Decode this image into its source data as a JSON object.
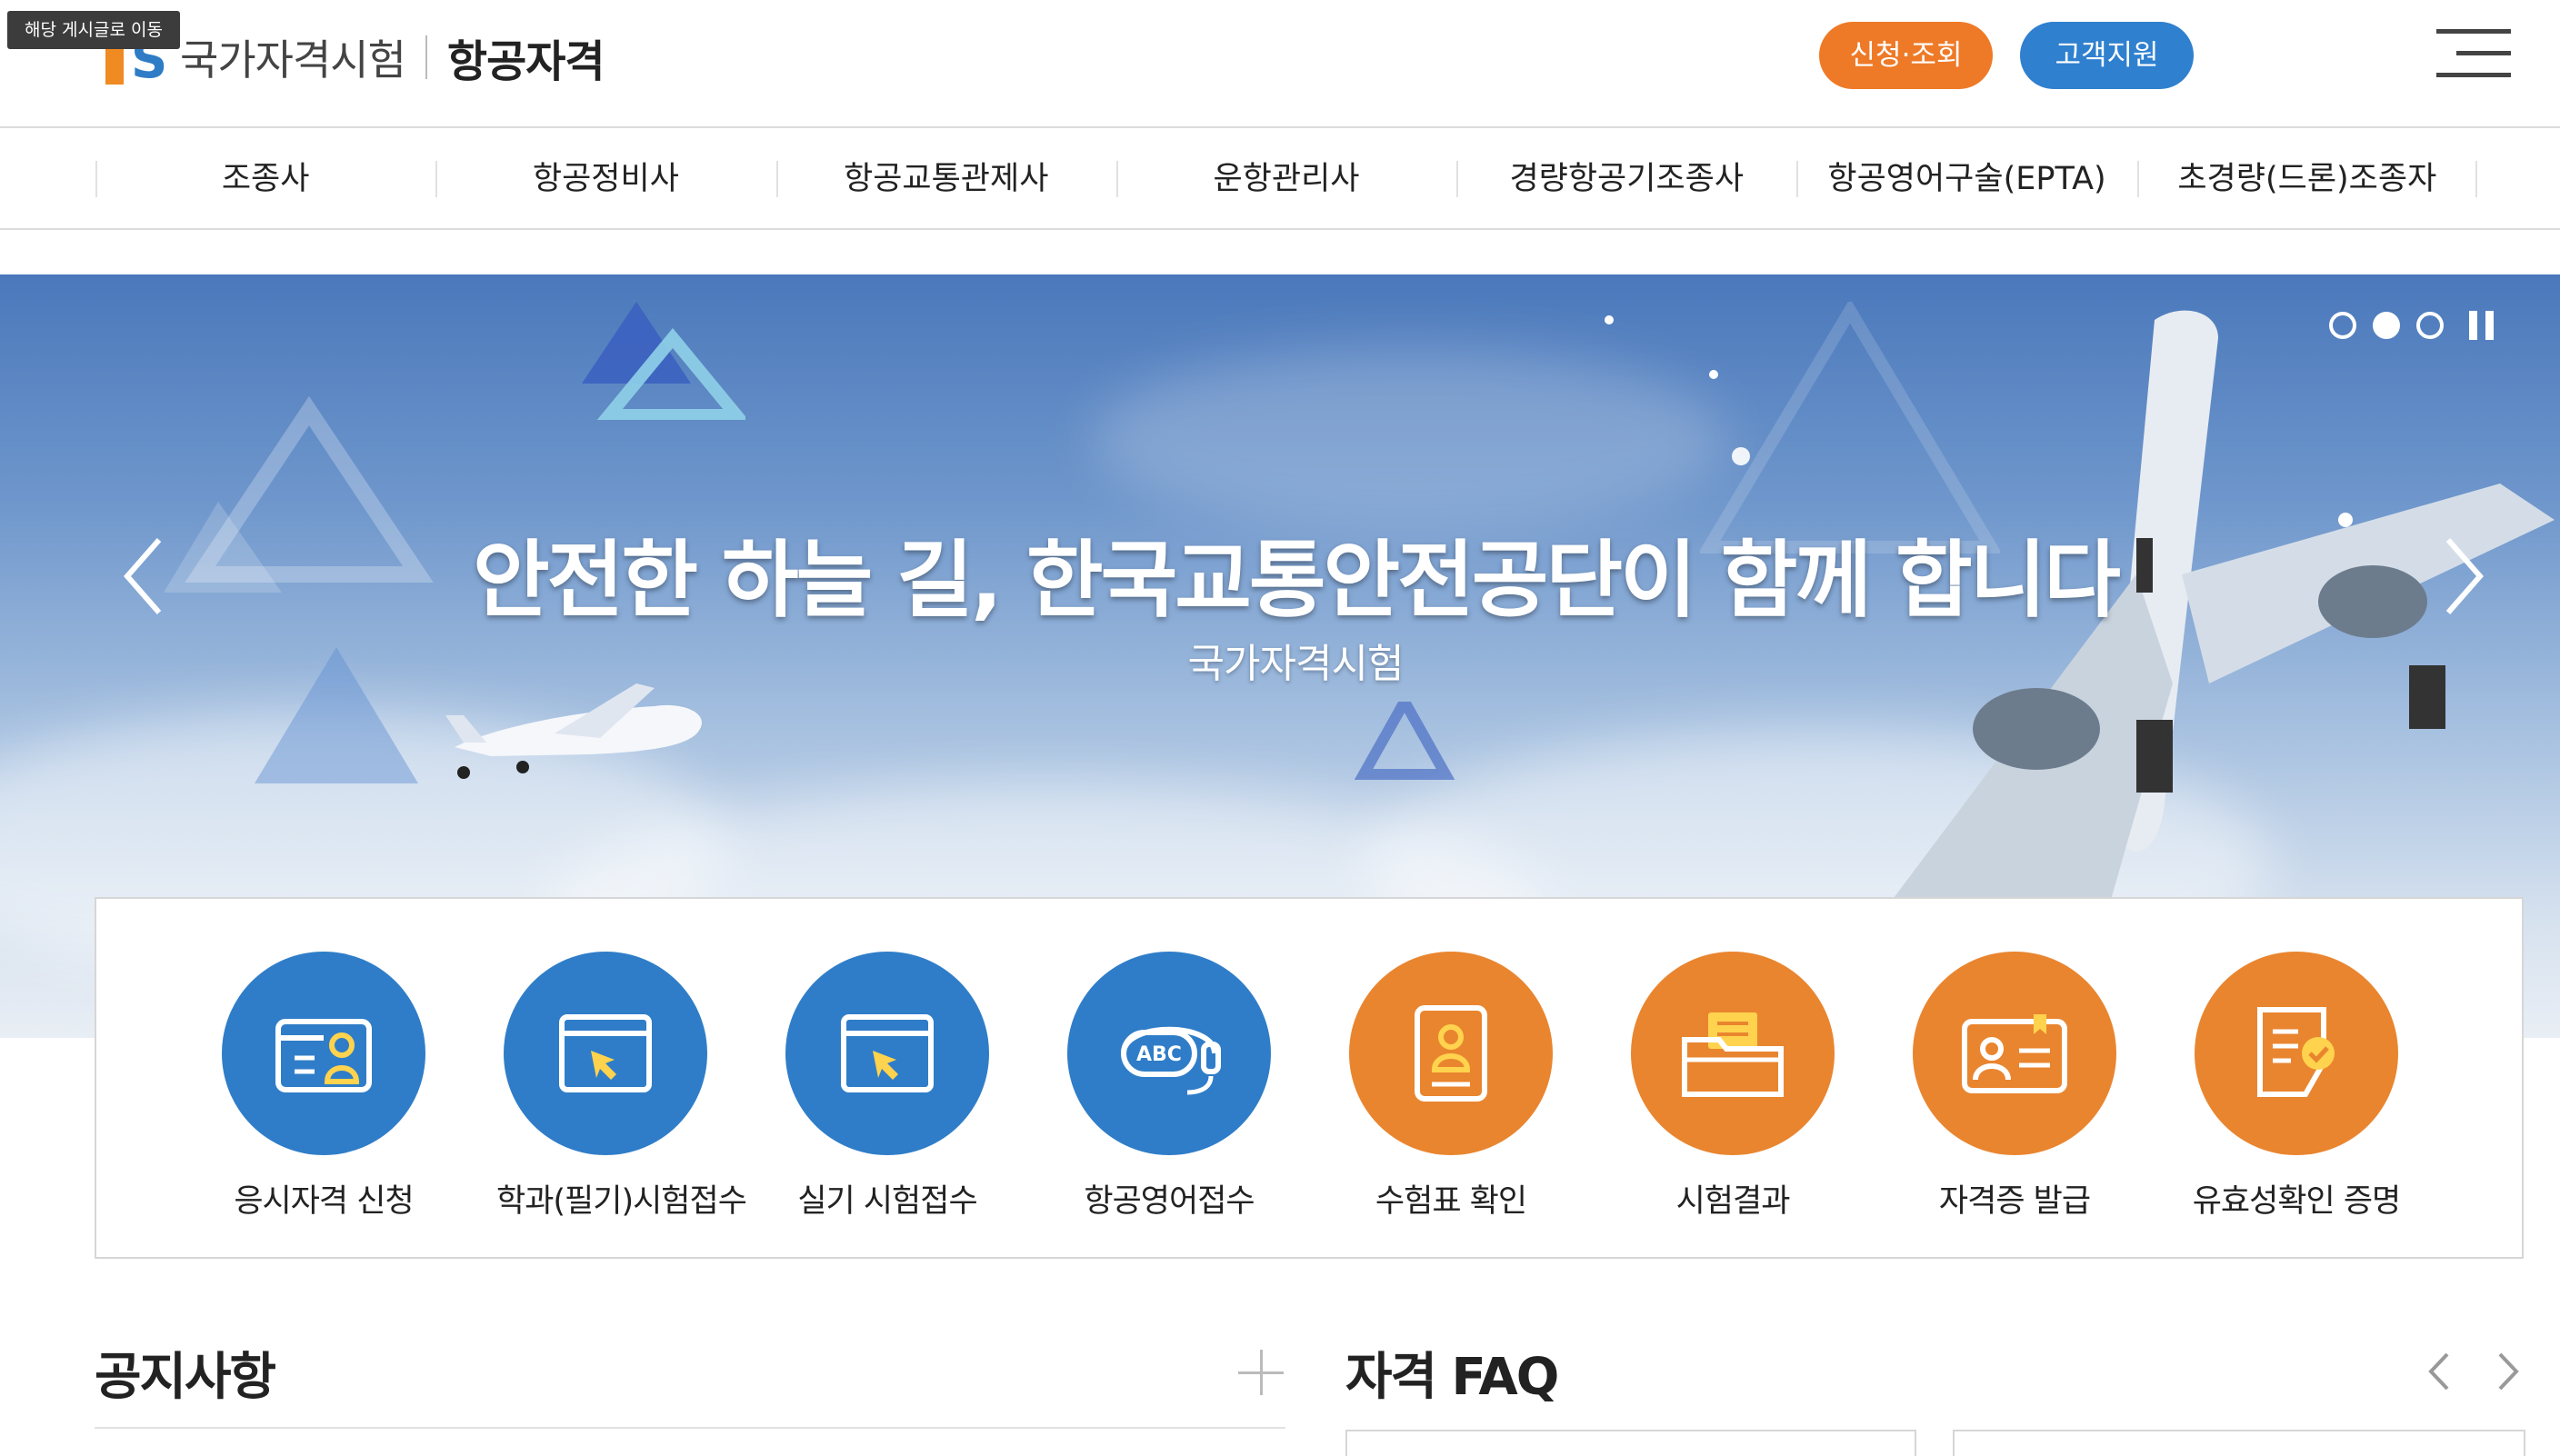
{
  "tooltip": "해당 게시글로 이동",
  "header": {
    "logo_main": "국가자격시험",
    "logo_sub": "항공자격",
    "apply_button": "신청·조회",
    "support_button": "고객지원"
  },
  "nav": {
    "items": [
      {
        "label": "조종사"
      },
      {
        "label": "항공정비사"
      },
      {
        "label": "항공교통관제사"
      },
      {
        "label": "운항관리사"
      },
      {
        "label": "경량항공기조종사"
      },
      {
        "label": "항공영어구술(EPTA)"
      },
      {
        "label": "초경량(드론)조종자"
      }
    ]
  },
  "hero": {
    "title": "안전한 하늘 길, 한국교통안전공단이 함께 합니다",
    "subtitle": "국가자격시험",
    "slides": 3,
    "active_slide": 2
  },
  "quick_menu": [
    {
      "label": "응시자격 신청",
      "icon": "id-card-icon",
      "color": "#2f7dc8"
    },
    {
      "label": "학과(필기)시험접수",
      "icon": "browser-cursor-icon",
      "color": "#2f7dc8"
    },
    {
      "label": "실기 시험접수",
      "icon": "browser-cursor-icon",
      "color": "#2f7dc8"
    },
    {
      "label": "항공영어접수",
      "icon": "abc-headset-icon",
      "color": "#2f7dc8"
    },
    {
      "label": "수험표 확인",
      "icon": "admission-ticket-icon",
      "color": "#e9852f"
    },
    {
      "label": "시험결과",
      "icon": "folder-documents-icon",
      "color": "#e9852f"
    },
    {
      "label": "자격증 발급",
      "icon": "license-card-icon",
      "color": "#e9852f"
    },
    {
      "label": "유효성확인 증명",
      "icon": "verified-document-icon",
      "color": "#e9852f"
    }
  ],
  "sections": {
    "notice_title": "공지사항",
    "faq_title": "자격 FAQ"
  },
  "colors": {
    "orange": "#ee7a27",
    "blue": "#2f80cf"
  }
}
